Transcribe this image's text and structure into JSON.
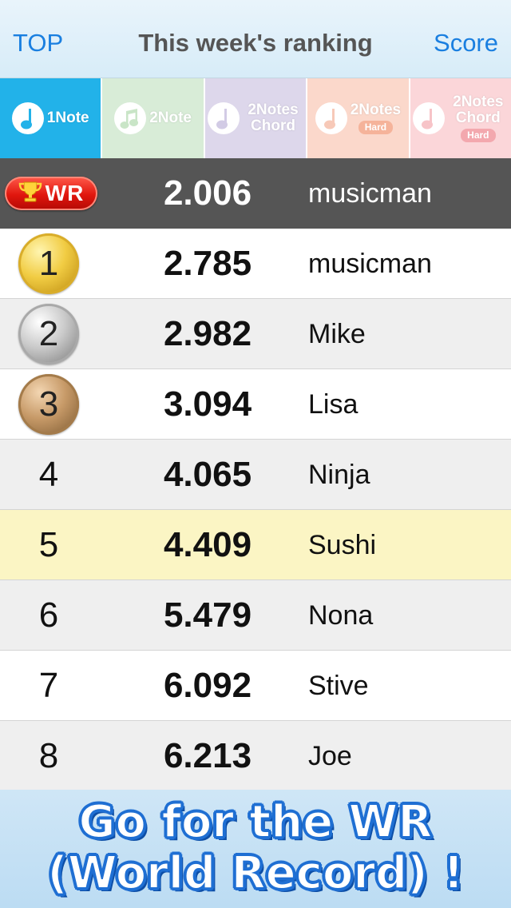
{
  "nav": {
    "left_label": "TOP",
    "title": "This week's ranking",
    "right_label": "Score"
  },
  "tabs": [
    {
      "label": "1Note",
      "badge": "",
      "selected": true,
      "icon": "single-note-icon"
    },
    {
      "label": "2Note",
      "badge": "",
      "selected": false,
      "icon": "double-note-icon"
    },
    {
      "label": "2Notes Chord",
      "badge": "",
      "selected": false,
      "icon": "single-note-icon"
    },
    {
      "label": "2Notes",
      "badge": "Hard",
      "selected": false,
      "icon": "single-note-icon"
    },
    {
      "label": "2Notes Chord",
      "badge": "Hard",
      "selected": false,
      "icon": "single-note-icon"
    }
  ],
  "world_record": {
    "badge": "WR",
    "score": "2.006",
    "name": "musicman"
  },
  "rankings": [
    {
      "rank": "1",
      "score": "2.785",
      "name": "musicman",
      "medal": "gold"
    },
    {
      "rank": "2",
      "score": "2.982",
      "name": "Mike",
      "medal": "silver"
    },
    {
      "rank": "3",
      "score": "3.094",
      "name": "Lisa",
      "medal": "bronze"
    },
    {
      "rank": "4",
      "score": "4.065",
      "name": "Ninja",
      "medal": ""
    },
    {
      "rank": "5",
      "score": "4.409",
      "name": "Sushi",
      "medal": "",
      "highlight": true
    },
    {
      "rank": "6",
      "score": "5.479",
      "name": "Nona",
      "medal": ""
    },
    {
      "rank": "7",
      "score": "6.092",
      "name": "Stive",
      "medal": ""
    },
    {
      "rank": "8",
      "score": "6.213",
      "name": "Joe",
      "medal": ""
    }
  ],
  "promo": {
    "line1": "Go for the WR",
    "line2": "(World Record) !"
  },
  "colors": {
    "accent": "#1a7fe0",
    "selected_tab": "#22b2e9",
    "wr_row": "#555555",
    "highlight_row": "#fbf5c4",
    "promo_text_outline": "#1f6fd3"
  }
}
